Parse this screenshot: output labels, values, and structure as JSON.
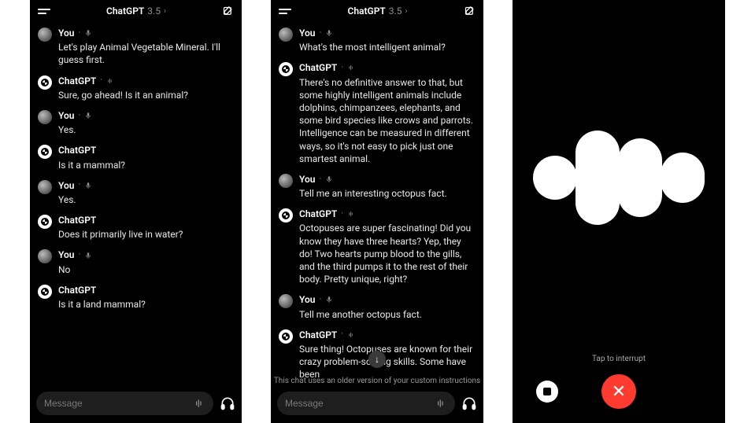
{
  "header": {
    "brand": "ChatGPT",
    "version": "3.5",
    "chevron": "›"
  },
  "screen1": {
    "messages": [
      {
        "sender": "You",
        "who": "user",
        "ind": "mic",
        "text": "Let's play Animal Vegetable Mineral. I'll guess first."
      },
      {
        "sender": "ChatGPT",
        "who": "gpt",
        "ind": "wave",
        "text": "Sure, go ahead! Is it an animal?"
      },
      {
        "sender": "You",
        "who": "user",
        "ind": "mic",
        "text": "Yes."
      },
      {
        "sender": "ChatGPT",
        "who": "gpt",
        "ind": null,
        "text": "Is it a mammal?"
      },
      {
        "sender": "You",
        "who": "user",
        "ind": "mic",
        "text": "Yes."
      },
      {
        "sender": "ChatGPT",
        "who": "gpt",
        "ind": null,
        "text": "Does it primarily live in water?"
      },
      {
        "sender": "You",
        "who": "user",
        "ind": "mic",
        "text": "No"
      },
      {
        "sender": "ChatGPT",
        "who": "gpt",
        "ind": null,
        "text": "Is it a land mammal?"
      }
    ],
    "input": {
      "placeholder": "Message"
    }
  },
  "screen2": {
    "messages": [
      {
        "sender": "You",
        "who": "user",
        "ind": "mic",
        "text": "What's the most intelligent animal?"
      },
      {
        "sender": "ChatGPT",
        "who": "gpt",
        "ind": "wave",
        "text": "There's no definitive answer to that, but some highly intelligent animals include dolphins, chimpanzees, elephants, and some bird species like crows and parrots. Intelligence can be measured in different ways, so it's not easy to pick just one smartest animal."
      },
      {
        "sender": "You",
        "who": "user",
        "ind": "mic",
        "text": "Tell me an interesting octopus fact."
      },
      {
        "sender": "ChatGPT",
        "who": "gpt",
        "ind": "wave",
        "text": "Octopuses are super fascinating! Did you know they have three hearts? Yep, they do! Two hearts pump blood to the gills, and the third pumps it to the rest of their body. Pretty unique, right?"
      },
      {
        "sender": "You",
        "who": "user",
        "ind": "mic",
        "text": "Tell me another octopus fact."
      },
      {
        "sender": "ChatGPT",
        "who": "gpt",
        "ind": "wave",
        "text": "Sure thing! Octopuses are known for their crazy problem-solving skills. Some have been"
      }
    ],
    "input": {
      "placeholder": "Message"
    },
    "scroll_down": "↓",
    "notice": "This chat uses an older version of your custom instructions"
  },
  "screen3": {
    "hint": "Tap to interrupt",
    "close_glyph": "✕"
  }
}
